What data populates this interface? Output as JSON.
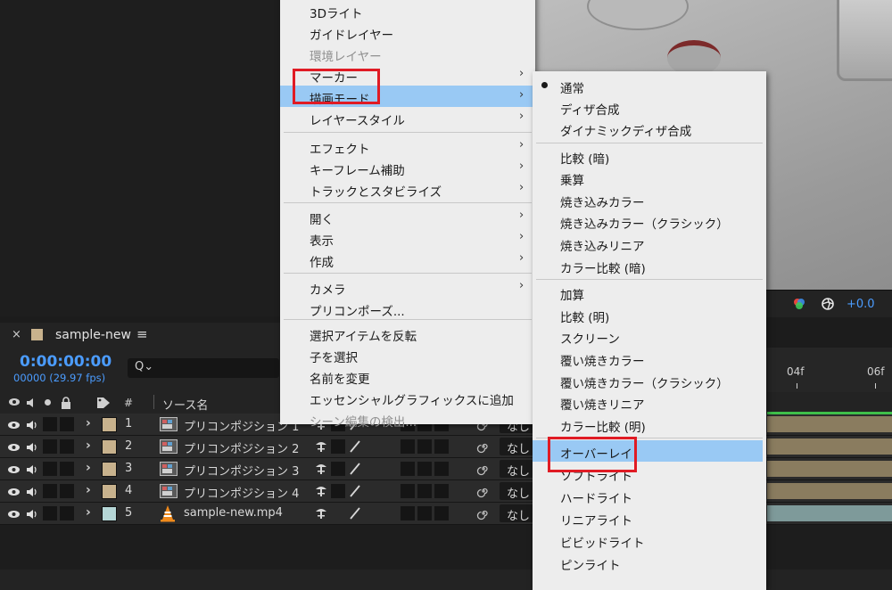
{
  "viewer": {
    "exposure": "+0.0"
  },
  "panel": {
    "comp_name": "sample-new",
    "close": "×",
    "menu": "≡"
  },
  "timeline": {
    "timecode": "0:00:00:00",
    "frame_info": "00000 (29.97 fps)",
    "search_icon": "Q⌄",
    "ruler_ticks": [
      "04f",
      "06f"
    ]
  },
  "columns": {
    "number": "#",
    "source_name": "ソース名"
  },
  "layers": [
    {
      "num": "1",
      "name": "プリコンポジション 1",
      "mode": "なし",
      "label_color": "#c8b28d",
      "type": "comp"
    },
    {
      "num": "2",
      "name": "プリコンポジション 2",
      "mode": "なし",
      "label_color": "#c8b28d",
      "type": "comp"
    },
    {
      "num": "3",
      "name": "プリコンポジション 3",
      "mode": "なし",
      "label_color": "#c8b28d",
      "type": "comp"
    },
    {
      "num": "4",
      "name": "プリコンポジション 4",
      "mode": "なし",
      "label_color": "#c8b28d",
      "type": "comp"
    },
    {
      "num": "5",
      "name": "sample-new.mp4",
      "mode": "なし",
      "label_color": "#b5d6d6",
      "type": "video"
    }
  ],
  "context_menu": [
    {
      "label": "3Dライト",
      "submenu": false,
      "disabled": false
    },
    {
      "label": "ガイドレイヤー",
      "submenu": false,
      "disabled": false
    },
    {
      "label": "環境レイヤー",
      "submenu": false,
      "disabled": true
    },
    {
      "label": "マーカー",
      "submenu": true,
      "disabled": false
    },
    {
      "label": "描画モード",
      "submenu": true,
      "disabled": false,
      "highlight": true
    },
    {
      "label": "レイヤースタイル",
      "submenu": true,
      "disabled": false
    },
    {
      "label": "エフェクト",
      "submenu": true,
      "disabled": false
    },
    {
      "label": "キーフレーム補助",
      "submenu": true,
      "disabled": false
    },
    {
      "label": "トラックとスタビライズ",
      "submenu": true,
      "disabled": false
    },
    {
      "label": "開く",
      "submenu": true,
      "disabled": false
    },
    {
      "label": "表示",
      "submenu": true,
      "disabled": false
    },
    {
      "label": "作成",
      "submenu": true,
      "disabled": false
    },
    {
      "label": "カメラ",
      "submenu": true,
      "disabled": false
    },
    {
      "label": "プリコンポーズ...",
      "submenu": false,
      "disabled": false
    },
    {
      "label": "選択アイテムを反転",
      "submenu": false,
      "disabled": false
    },
    {
      "label": "子を選択",
      "submenu": false,
      "disabled": false
    },
    {
      "label": "名前を変更",
      "submenu": false,
      "disabled": false
    },
    {
      "label": "エッセンシャルグラフィックスに追加",
      "submenu": false,
      "disabled": false
    },
    {
      "label": "シーン編集の検出...",
      "submenu": false,
      "disabled": true
    }
  ],
  "blend_submenu": [
    {
      "label": "通常",
      "checked": true
    },
    {
      "label": "ディザ合成"
    },
    {
      "label": "ダイナミックディザ合成"
    },
    {
      "label": "比較 (暗)"
    },
    {
      "label": "乗算"
    },
    {
      "label": "焼き込みカラー"
    },
    {
      "label": "焼き込みカラー（クラシック）"
    },
    {
      "label": "焼き込みリニア"
    },
    {
      "label": "カラー比較 (暗)"
    },
    {
      "label": "加算"
    },
    {
      "label": "比較 (明)"
    },
    {
      "label": "スクリーン"
    },
    {
      "label": "覆い焼きカラー"
    },
    {
      "label": "覆い焼きカラー（クラシック）"
    },
    {
      "label": "覆い焼きリニア"
    },
    {
      "label": "カラー比較 (明)"
    },
    {
      "label": "オーバーレイ",
      "highlight": true
    },
    {
      "label": "ソフトライト"
    },
    {
      "label": "ハードライト"
    },
    {
      "label": "リニアライト"
    },
    {
      "label": "ビビッドライト"
    },
    {
      "label": "ピンライト"
    }
  ],
  "colors": {
    "menu_highlight": "#99c9f4",
    "annotation_red": "#e01b24",
    "timecode_blue": "#4b9cff"
  }
}
